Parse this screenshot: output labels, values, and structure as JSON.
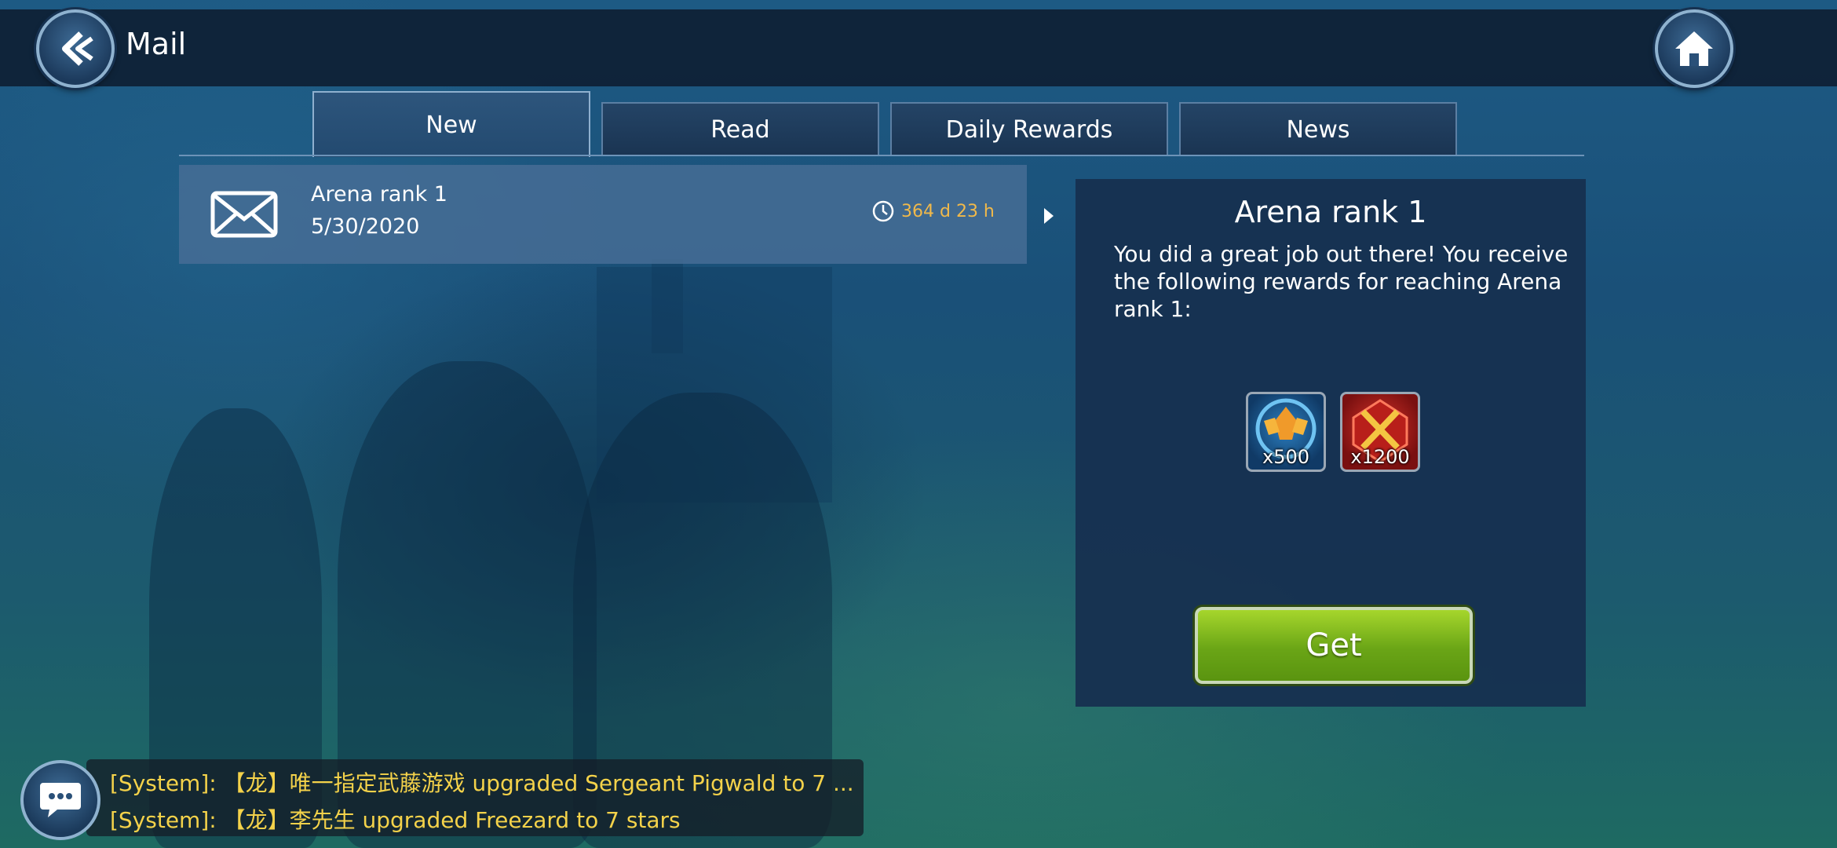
{
  "header": {
    "title": "Mail",
    "back_icon": "double-chevron-left-icon",
    "home_icon": "home-icon"
  },
  "tabs": [
    {
      "label": "New",
      "active": true
    },
    {
      "label": "Read",
      "active": false
    },
    {
      "label": "Daily Rewards",
      "active": false
    },
    {
      "label": "News",
      "active": false
    }
  ],
  "mail_list": [
    {
      "subject": "Arena rank 1",
      "date": "5/30/2020",
      "expires": "364 d 23 h",
      "icon": "envelope-icon"
    }
  ],
  "detail": {
    "title": "Arena rank 1",
    "body": "You did a great job out there! You receive the following rewards for reaching Arena rank 1:",
    "rewards": [
      {
        "name": "arena-token",
        "count": "x500",
        "icon": "arena-medal-icon"
      },
      {
        "name": "arena-gem",
        "count": "x1200",
        "icon": "crossed-swords-gem-icon"
      }
    ],
    "get_label": "Get"
  },
  "chat": {
    "lines": [
      "[System]: 【龙】唯一指定武藤游戏 upgraded Sergeant Pigwald to 7 ...",
      "[System]: 【龙】李先生 upgraded Freezard to 7 stars"
    ]
  },
  "colors": {
    "timer": "#f1b94a",
    "chat_text": "#f4d24a",
    "get_button": "#7bb81c"
  }
}
